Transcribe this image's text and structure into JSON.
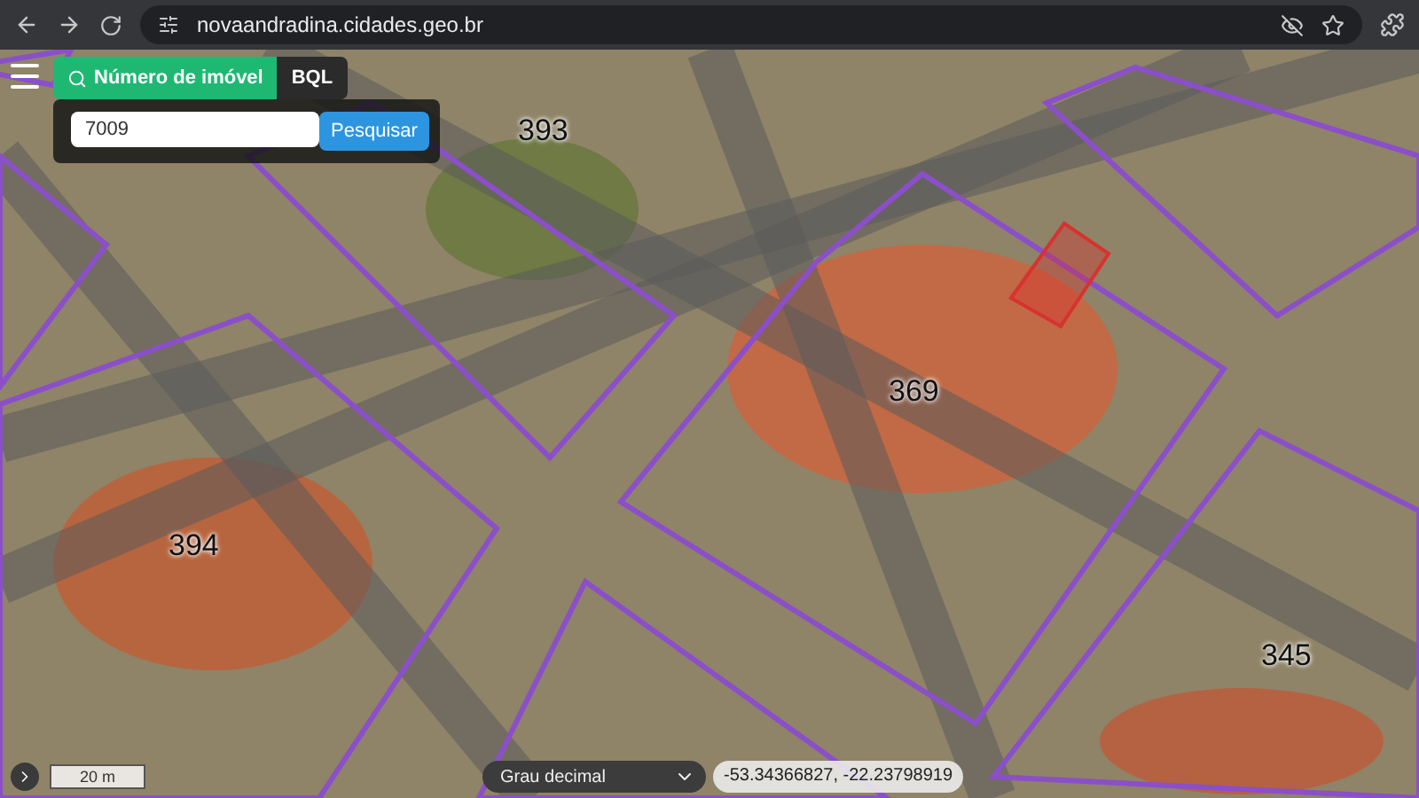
{
  "browser": {
    "url": "novaandradina.cidades.geo.br"
  },
  "search_modes": [
    {
      "label": "Número de imóvel",
      "selected": true
    },
    {
      "label": "BQL",
      "selected": false
    }
  ],
  "search": {
    "value": "7009",
    "button": "Pesquisar"
  },
  "map": {
    "block_labels": [
      "393",
      "369",
      "394",
      "345"
    ],
    "scale": "20 m"
  },
  "coordinates": {
    "format": "Grau decimal",
    "value": "-53.34366827, -22.23798919"
  }
}
